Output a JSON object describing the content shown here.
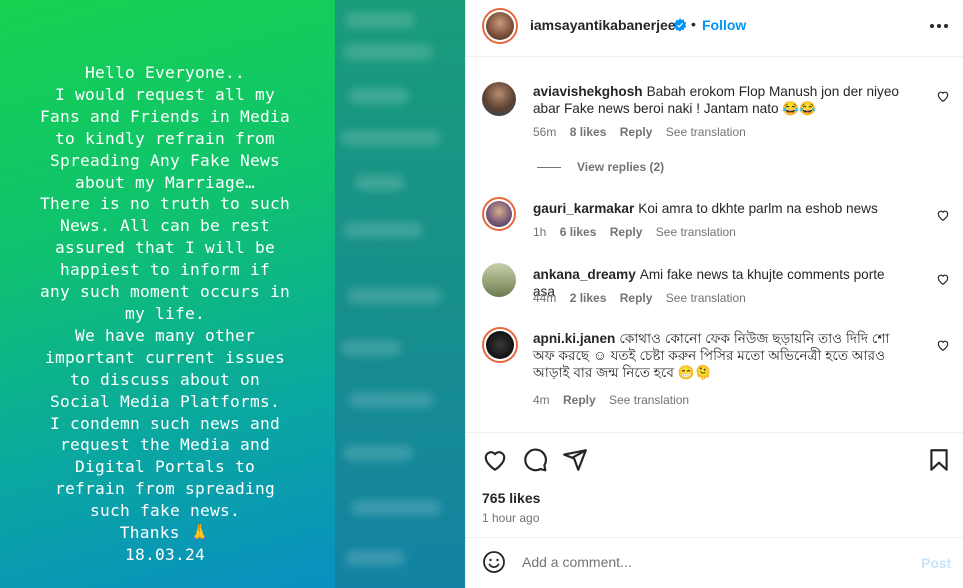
{
  "post_image": {
    "text": "Hello Everyone..\nI would request all my\nFans and Friends in Media\nto kindly refrain from\nSpreading Any Fake News\nabout my Marriage…\nThere is no truth to such\nNews. All can be rest\nassured that I will be\nhappiest to inform  if\nany such moment occurs in\nmy life.\nWe have many other\nimportant current issues\nto discuss about on\nSocial Media Platforms.\nI condemn such news and\nrequest the Media and\nDigital Portals to\nrefrain from spreading\nsuch fake news.\nThanks 🙏\n18.03.24"
  },
  "header": {
    "username": "iamsayantikabanerjee",
    "separator": "•",
    "follow_label": "Follow"
  },
  "comments": [
    {
      "username": "aviavishekghosh",
      "text": "Babah erokom Flop Manush jon der niyeo abar Fake news beroi naki ! Jantam nato 😂😂",
      "time": "56m",
      "likes": "8 likes",
      "reply": "Reply",
      "translate": "See translation"
    },
    {
      "username": "gauri_karmakar",
      "text": "Koi amra to dkhte parlm na eshob news",
      "time": "1h",
      "likes": "6 likes",
      "reply": "Reply",
      "translate": "See translation"
    },
    {
      "username": "ankana_dreamy",
      "text": "Ami fake news ta khujte comments porte asa",
      "time": "44m",
      "likes": "2 likes",
      "reply": "Reply",
      "translate": "See translation"
    },
    {
      "username": "apni.ki.janen",
      "text": "কোথাও কোনো ফেক নিউজ ছড়ায়নি তাও দিদি শো অফ করছে ☺ যতই চেষ্টা করুন পিসির মতো অভিনেত্রী হতে আরও আড়াই বার জন্ম নিতে হবে 😁🫠",
      "time": "4m",
      "reply": "Reply",
      "translate": "See translation"
    }
  ],
  "view_replies": "View replies (2)",
  "likes_count": "765 likes",
  "posted_time": "1 hour ago",
  "add_comment": {
    "placeholder": "Add a comment...",
    "post_label": "Post"
  },
  "colors": {
    "accent": "#0095f6",
    "gradient_top": "#14d24f",
    "gradient_bottom": "#0a8fc1"
  }
}
